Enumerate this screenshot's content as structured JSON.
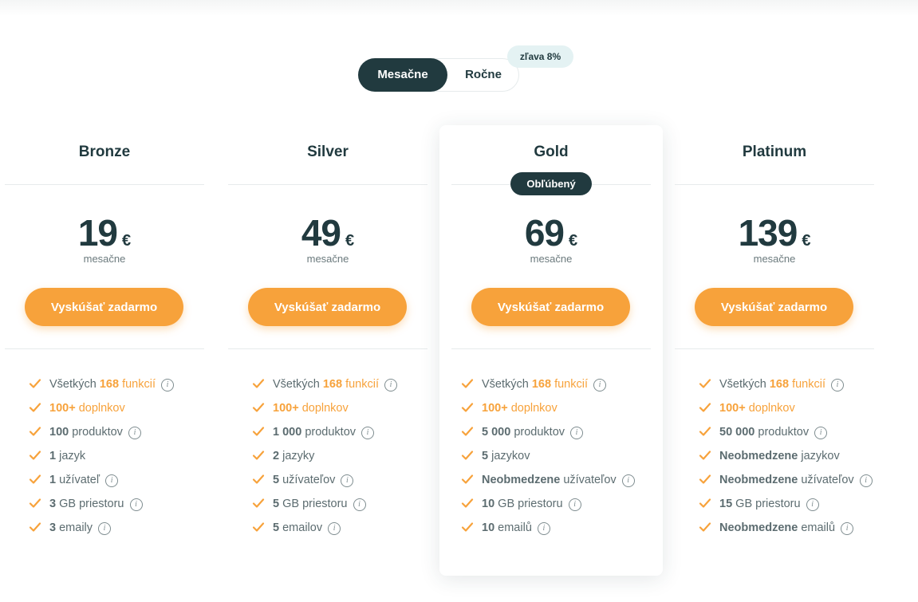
{
  "billing": {
    "monthly_label": "Mesačne",
    "yearly_label": "Ročne",
    "yearly_discount": "zľava 8%"
  },
  "colors": {
    "dark": "#213a3f",
    "accent": "#f7a23b",
    "badge_bg": "#e4f2f3",
    "muted_text": "#5c6c70"
  },
  "plans": [
    {
      "name": "Bronze",
      "price": "19",
      "currency": "€",
      "period": "mesačne",
      "cta": "Vyskúšať zadarmo",
      "features": {
        "functions": {
          "prefix": "Všetkých ",
          "value": "168",
          "suffix": " funkcií"
        },
        "addons": {
          "value": "100+",
          "suffix": " doplnkov"
        },
        "products": {
          "value": "100",
          "suffix": " produktov"
        },
        "languages": {
          "value": "1",
          "suffix": " jazyk"
        },
        "users": {
          "value": "1",
          "suffix": " užívateľ"
        },
        "storage": {
          "value": "3",
          "suffix": " GB priestoru"
        },
        "emails": {
          "value": "3",
          "suffix": " emaily"
        }
      }
    },
    {
      "name": "Silver",
      "price": "49",
      "currency": "€",
      "period": "mesačne",
      "cta": "Vyskúšať zadarmo",
      "features": {
        "functions": {
          "prefix": "Všetkých ",
          "value": "168",
          "suffix": " funkcií"
        },
        "addons": {
          "value": "100+",
          "suffix": " doplnkov"
        },
        "products": {
          "value": "1 000",
          "suffix": " produktov"
        },
        "languages": {
          "value": "2",
          "suffix": " jazyky"
        },
        "users": {
          "value": "5",
          "suffix": " užívateľov"
        },
        "storage": {
          "value": "5",
          "suffix": " GB priestoru"
        },
        "emails": {
          "value": "5",
          "suffix": " emailov"
        }
      }
    },
    {
      "name": "Gold",
      "badge": "Obľúbený",
      "price": "69",
      "currency": "€",
      "period": "mesačne",
      "cta": "Vyskúšať zadarmo",
      "features": {
        "functions": {
          "prefix": "Všetkých ",
          "value": "168",
          "suffix": " funkcií"
        },
        "addons": {
          "value": "100+",
          "suffix": " doplnkov"
        },
        "products": {
          "value": "5 000",
          "suffix": " produktov"
        },
        "languages": {
          "value": "5",
          "suffix": " jazykov"
        },
        "users": {
          "value": "Neobmedzene",
          "suffix": " užívateľov"
        },
        "storage": {
          "value": "10",
          "suffix": " GB priestoru"
        },
        "emails": {
          "value": "10",
          "suffix": " emailů"
        }
      }
    },
    {
      "name": "Platinum",
      "price": "139",
      "currency": "€",
      "period": "mesačne",
      "cta": "Vyskúšať zadarmo",
      "features": {
        "functions": {
          "prefix": "Všetkých ",
          "value": "168",
          "suffix": " funkcií"
        },
        "addons": {
          "value": "100+",
          "suffix": " doplnkov"
        },
        "products": {
          "value": "50 000",
          "suffix": " produktov"
        },
        "languages": {
          "value": "Neobmedzene",
          "suffix": " jazykov"
        },
        "users": {
          "value": "Neobmedzene",
          "suffix": " užívateľov"
        },
        "storage": {
          "value": "15",
          "suffix": " GB priestoru"
        },
        "emails": {
          "value": "Neobmedzene",
          "suffix": " emailů"
        }
      }
    }
  ]
}
